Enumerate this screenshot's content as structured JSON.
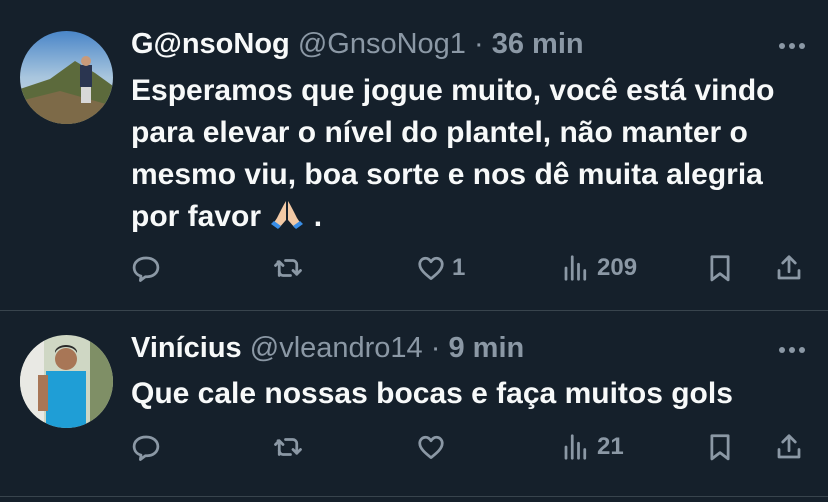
{
  "tweets": [
    {
      "name": "G@nsoNog",
      "handle": "@GnsoNog1",
      "separator": "·",
      "time": "36 min",
      "text": "Esperamos que jogue muito, você está vindo para elevar o nível do plantel, não manter o mesmo viu, boa sorte e nos dê muita alegria por favor",
      "text_suffix": " .",
      "emoji": "folded-hands-emoji",
      "likes": "1",
      "views": "209"
    },
    {
      "name": "Vinícius",
      "handle": "@vleandro14",
      "separator": "·",
      "time": "9 min",
      "text": "Que cale nossas bocas e faça muitos gols",
      "likes": "",
      "views": "21"
    }
  ],
  "icons": [
    "reply-icon",
    "retweet-icon",
    "like-icon",
    "views-icon",
    "bookmark-icon",
    "share-icon",
    "more-icon"
  ],
  "colors": {
    "background": "#15202b",
    "text": "#f7f9f9",
    "secondary": "#8b98a5",
    "divider": "#38444d"
  }
}
